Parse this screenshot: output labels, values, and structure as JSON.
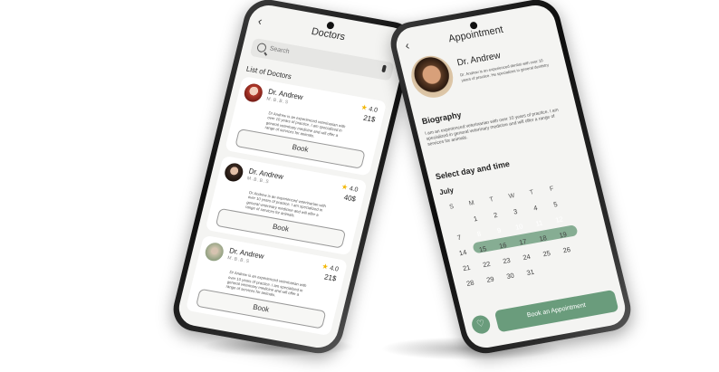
{
  "left_screen": {
    "title": "Doctors",
    "search_placeholder": "Search",
    "section_title": "List of Doctors",
    "doctors": [
      {
        "name": "Dr. Andrew",
        "degree": "M.B.B.S",
        "rating": "4.0",
        "price": "21$",
        "description": "Dr Andrew is an experienced veterinarian with over 10 years of practice. I am specialized in general veterinary medicine and will offer a range of services for animals.",
        "book_label": "Book"
      },
      {
        "name": "Dr. Andrew",
        "degree": "M.B.B.S",
        "rating": "4.0",
        "price": "40$",
        "description": "Dr Andrew is an experienced veterinarian with over 10 years of practice. I am specialized in general veterinary medicine and will offer a range of services for animals.",
        "book_label": "Book"
      },
      {
        "name": "Dr. Andrew",
        "degree": "M.B.B.S",
        "rating": "4.0",
        "price": "21$",
        "description": "Dr Andrew is an experienced veterinarian with over 10 years of practice. I am specialized in general veterinary medicine and will offer a range of services for animals.",
        "book_label": "Book"
      }
    ]
  },
  "right_screen": {
    "title": "Appointment",
    "doctor_name": "Dr. Andrew",
    "doctor_summary": "Dr. Andrew is an experienced dentist with over 10 years of practice. He specializes in general dentistry",
    "bio_heading": "Biography",
    "bio_text": "I am an experienced veterinarian with over 10 years of practice. I am specialized in general veterinary medicine and will offer a range of services for animals.",
    "select_heading": "Select day and time",
    "month": "July",
    "weekdays": [
      "S",
      "M",
      "T",
      "W",
      "T",
      "F"
    ],
    "weeks": [
      [
        "",
        "1",
        "",
        "",
        "",
        ""
      ],
      [
        "",
        "",
        "1",
        "",
        "",
        ""
      ],
      [
        "7",
        "8",
        "9",
        "10",
        "11",
        "12"
      ],
      [
        "14",
        "15",
        "",
        "",
        "",
        ""
      ],
      [
        "",
        "",
        "",
        "",
        "",
        ""
      ],
      [
        "",
        "",
        "",
        "",
        "",
        ""
      ]
    ],
    "calendar_rows": [
      [
        "",
        "1",
        "2",
        "3",
        "4",
        "5"
      ],
      [
        "",
        "",
        "",
        "",
        "",
        ""
      ],
      [
        "7",
        "8",
        "9",
        "10",
        "11",
        "12"
      ],
      [
        "14",
        "15",
        "16",
        "17",
        "18",
        "19"
      ],
      [
        "21",
        "22",
        "23",
        "24",
        "25",
        "26"
      ],
      [
        "28",
        "29",
        "30",
        "31",
        "",
        ""
      ]
    ],
    "selected_days": [
      "8",
      "9",
      "10",
      "11",
      "12"
    ],
    "book_label": "Book an Appointment",
    "accent_color": "#6a9c7c"
  }
}
